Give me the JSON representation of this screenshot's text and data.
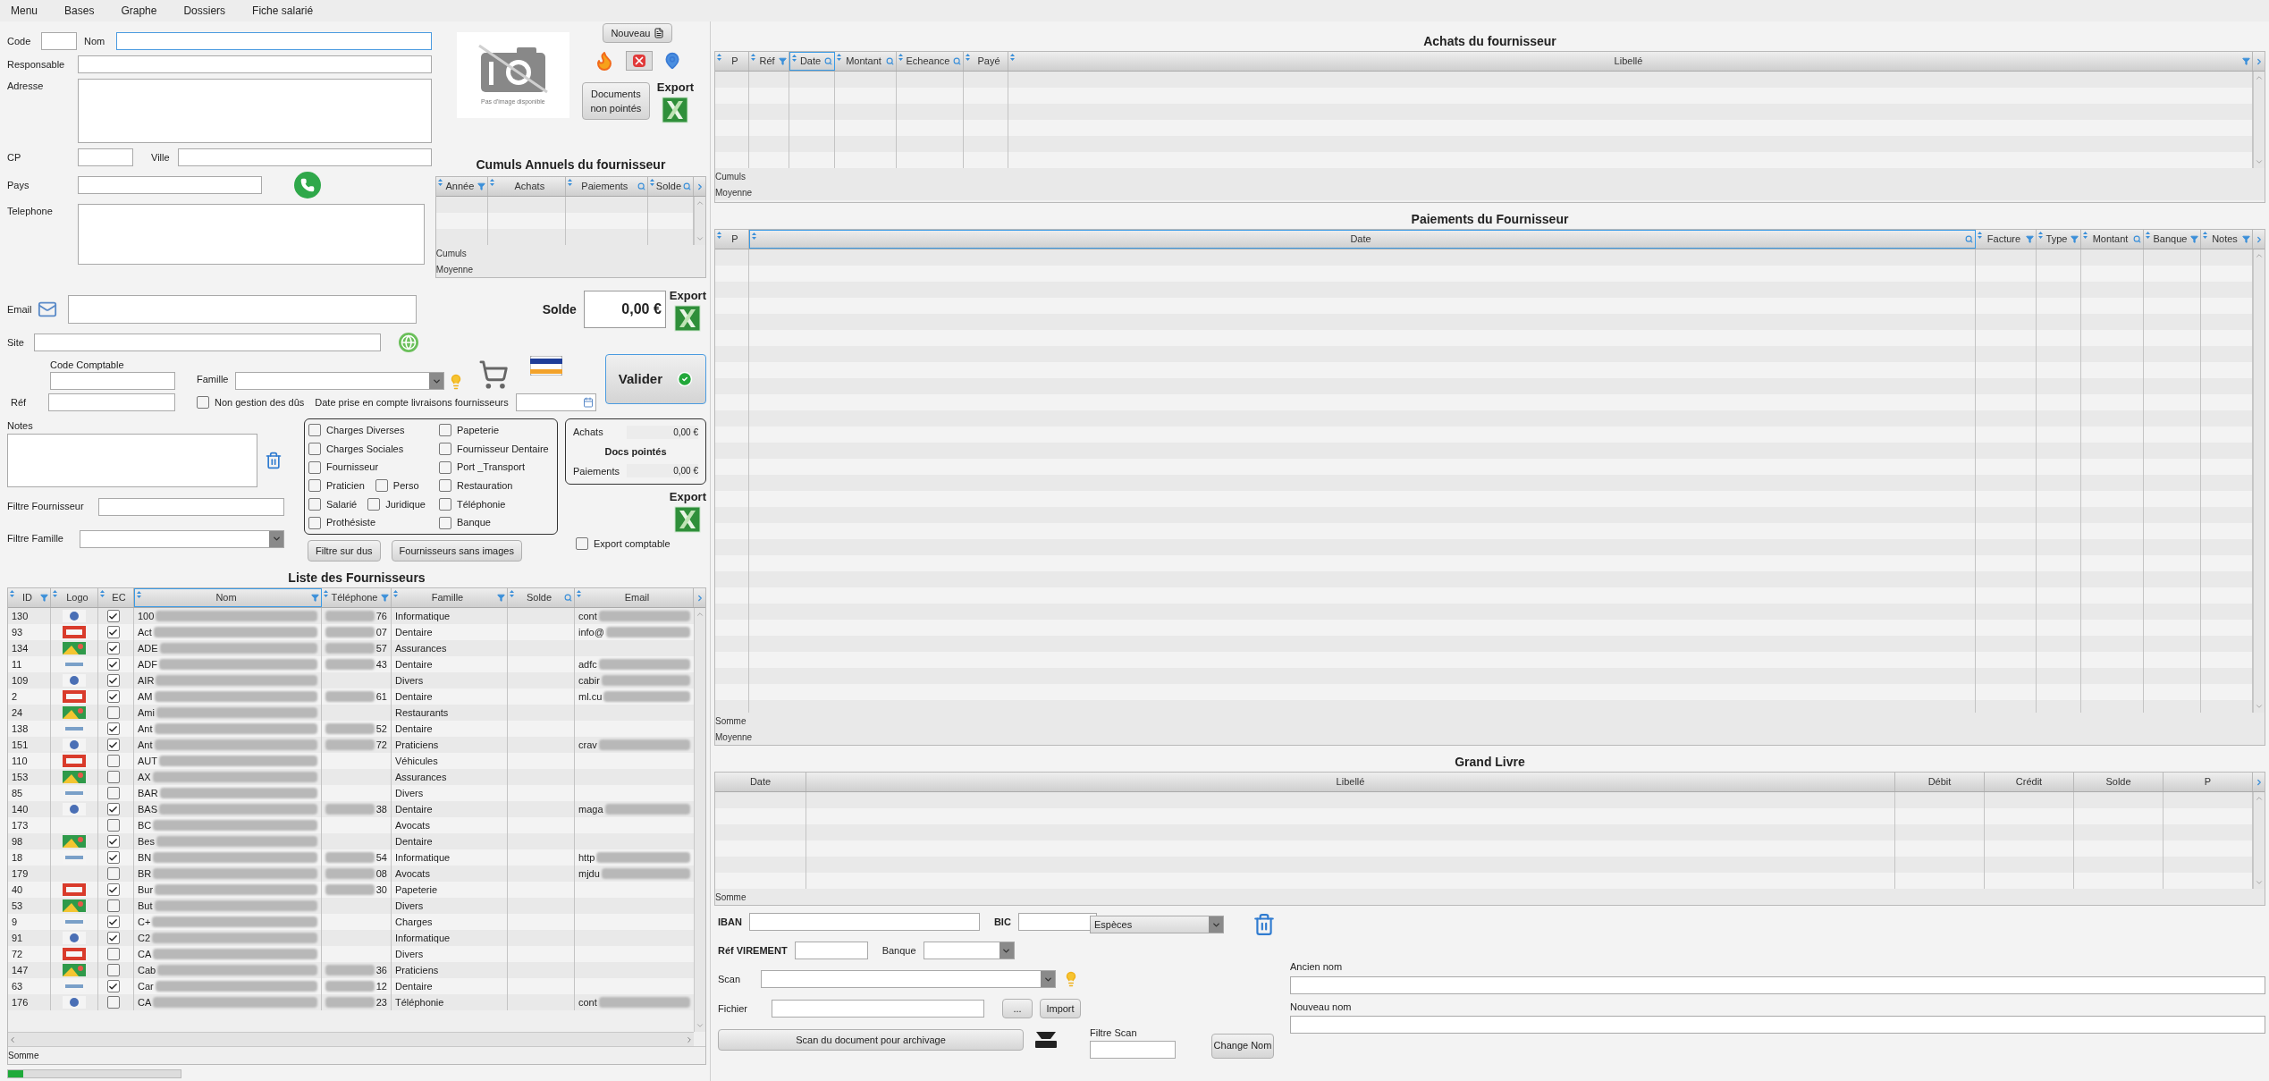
{
  "menu": [
    {
      "label": "Menu"
    },
    {
      "label": "Bases"
    },
    {
      "label": "Graphe"
    },
    {
      "label": "Dossiers"
    },
    {
      "label": "Fiche salarié"
    }
  ],
  "form": {
    "code": "Code",
    "nom": "Nom",
    "responsable": "Responsable",
    "adresse": "Adresse",
    "cp": "CP",
    "ville": "Ville",
    "pays": "Pays",
    "telephone": "Telephone",
    "email": "Email",
    "site": "Site",
    "code_comptable": "Code Comptable",
    "famille": "Famille",
    "ref": "Réf",
    "notes": "Notes",
    "filtre_fournisseur": "Filtre Fournisseur",
    "filtre_famille": "Filtre Famille",
    "date_prise": "Date prise en compte livraisons fournisseurs"
  },
  "non_gestion": {
    "label": "Non gestion des dûs",
    "checked": false
  },
  "photo_placeholder": {
    "caption": "Pas d'image disponible"
  },
  "buttons": {
    "nouveau": "Nouveau",
    "documents": "Documents non pointés",
    "valider": "Valider",
    "filtre_dus": "Filtre sur dus",
    "sans_images": "Fournisseurs sans images"
  },
  "exports": [
    "Export",
    "Export",
    "Export"
  ],
  "solde": {
    "label": "Solde",
    "value": "0,00 €"
  },
  "cumuls": {
    "title": "Cumuls Annuels du fournisseur",
    "columns": [
      {
        "label": "Année",
        "kind": "filter",
        "selected": false
      },
      {
        "label": "Achats",
        "kind": "plain",
        "selected": false
      },
      {
        "label": "Paiements",
        "kind": "search",
        "selected": false
      },
      {
        "label": "Solde",
        "kind": "search",
        "selected": false
      }
    ],
    "footer": [
      "Cumuls",
      "Moyenne"
    ]
  },
  "categories": [
    {
      "left": [
        {
          "label": "Charges Diverses",
          "checked": false
        }
      ],
      "right": {
        "label": "Papeterie",
        "checked": false
      }
    },
    {
      "left": [
        {
          "label": "Charges Sociales",
          "checked": false
        }
      ],
      "right": {
        "label": "Fournisseur Dentaire",
        "checked": false
      }
    },
    {
      "left": [
        {
          "label": "Fournisseur",
          "checked": false
        }
      ],
      "right": {
        "label": "Port _Transport",
        "checked": false
      }
    },
    {
      "left": [
        {
          "label": "Praticien",
          "checked": false
        },
        {
          "label": "Perso",
          "checked": false
        }
      ],
      "right": {
        "label": "Restauration",
        "checked": false
      }
    },
    {
      "left": [
        {
          "label": "Salarié",
          "checked": false
        },
        {
          "label": "Juridique",
          "checked": false
        }
      ],
      "right": {
        "label": "Téléphonie",
        "checked": false
      }
    },
    {
      "left": [
        {
          "label": "Prothésiste",
          "checked": false
        }
      ],
      "right": {
        "label": "Banque",
        "checked": false
      }
    }
  ],
  "summary": {
    "achats_label": "Achats",
    "achats_value": "0,00 €",
    "docs_label": "Docs pointés",
    "paiements_label": "Paiements",
    "paiements_value": "0,00 €"
  },
  "export_comptable": {
    "label": "Export comptable",
    "checked": false
  },
  "suppliers": {
    "title": "Liste des Fournisseurs",
    "columns": [
      {
        "label": "ID",
        "kind": "filter",
        "selected": false
      },
      {
        "label": "Logo",
        "kind": "plain",
        "selected": false
      },
      {
        "label": "EC",
        "kind": "plain",
        "selected": false
      },
      {
        "label": "Nom",
        "kind": "filter",
        "selected": true
      },
      {
        "label": "Téléphone",
        "kind": "filter",
        "selected": false
      },
      {
        "label": "Famille",
        "kind": "filter",
        "selected": false
      },
      {
        "label": "Solde",
        "kind": "search",
        "selected": false
      },
      {
        "label": "Email",
        "kind": "plain",
        "selected": false
      }
    ],
    "rows": [
      {
        "id": "130",
        "logo": true,
        "ec": true,
        "nom": "100",
        "tel": "76",
        "famille": "Informatique",
        "email": "cont"
      },
      {
        "id": "93",
        "logo": true,
        "ec": true,
        "nom": "Act",
        "tel": "07",
        "famille": "Dentaire",
        "email": "info@"
      },
      {
        "id": "134",
        "logo": true,
        "ec": true,
        "nom": "ADE",
        "tel": "57",
        "famille": "Assurances"
      },
      {
        "id": "11",
        "logo": true,
        "ec": true,
        "nom": "ADF",
        "tel": "43",
        "famille": "Dentaire",
        "email": "adfc"
      },
      {
        "id": "109",
        "logo": true,
        "ec": true,
        "nom": "AIR",
        "famille": "Divers",
        "email": "cabir"
      },
      {
        "id": "2",
        "logo": true,
        "ec": true,
        "nom": "AM",
        "tel": "61",
        "famille": "Dentaire",
        "email": "ml.cu"
      },
      {
        "id": "24",
        "logo": true,
        "ec": false,
        "nom": "Ami",
        "famille": "Restaurants"
      },
      {
        "id": "138",
        "logo": true,
        "ec": true,
        "nom": "Ant",
        "tel": "52",
        "famille": "Dentaire"
      },
      {
        "id": "151",
        "logo": true,
        "ec": true,
        "nom": "Ant",
        "tel": "72",
        "famille": "Praticiens",
        "email": "crav"
      },
      {
        "id": "110",
        "logo": true,
        "ec": false,
        "nom": "AUT",
        "famille": "Véhicules"
      },
      {
        "id": "153",
        "logo": true,
        "ec": false,
        "nom": "AX",
        "famille": "Assurances"
      },
      {
        "id": "85",
        "logo": true,
        "ec": false,
        "nom": "BAR",
        "famille": "Divers"
      },
      {
        "id": "140",
        "logo": true,
        "ec": true,
        "nom": "BAS",
        "tel": "38",
        "famille": "Dentaire",
        "email": "maga"
      },
      {
        "id": "173",
        "logo": false,
        "ec": false,
        "nom": "BC",
        "famille": "Avocats"
      },
      {
        "id": "98",
        "logo": true,
        "ec": true,
        "nom": "Bes",
        "famille": "Dentaire"
      },
      {
        "id": "18",
        "logo": true,
        "ec": true,
        "nom": "BN",
        "tel": "54",
        "famille": "Informatique",
        "email": "http"
      },
      {
        "id": "179",
        "logo": false,
        "ec": false,
        "nom": "BR",
        "tel": "08",
        "famille": "Avocats",
        "email": "mjdu"
      },
      {
        "id": "40",
        "logo": true,
        "ec": true,
        "nom": "Bur",
        "tel": "30",
        "famille": "Papeterie"
      },
      {
        "id": "53",
        "logo": true,
        "ec": false,
        "nom": "But",
        "famille": "Divers"
      },
      {
        "id": "9",
        "logo": true,
        "ec": true,
        "nom": "C+",
        "famille": "Charges"
      },
      {
        "id": "91",
        "logo": true,
        "ec": true,
        "nom": "C2",
        "famille": "Informatique"
      },
      {
        "id": "72",
        "logo": true,
        "ec": false,
        "nom": "CA",
        "famille": "Divers"
      },
      {
        "id": "147",
        "logo": true,
        "ec": false,
        "nom": "Cab",
        "tel": "36",
        "famille": "Praticiens"
      },
      {
        "id": "63",
        "logo": true,
        "ec": true,
        "nom": "Car",
        "tel": "12",
        "famille": "Dentaire"
      },
      {
        "id": "176",
        "logo": true,
        "ec": false,
        "nom": "CA",
        "tel": "23",
        "famille": "Téléphonie",
        "email": "cont"
      }
    ],
    "footer": "Somme"
  },
  "status": {
    "level": 0.09
  },
  "achats": {
    "title": "Achats du fournisseur",
    "columns": [
      {
        "label": "P",
        "kind": "plain",
        "selected": false
      },
      {
        "label": "Réf",
        "kind": "filter",
        "selected": false
      },
      {
        "label": "Date",
        "kind": "search",
        "selected": true
      },
      {
        "label": "Montant",
        "kind": "search",
        "selected": false
      },
      {
        "label": "Echeance",
        "kind": "search",
        "selected": false
      },
      {
        "label": "Payé",
        "kind": "plain",
        "selected": false
      },
      {
        "label": "Libellé",
        "kind": "filter",
        "selected": false
      }
    ],
    "footer": [
      "Cumuls",
      "Moyenne"
    ]
  },
  "paiements": {
    "title": "Paiements du Fournisseur",
    "columns": [
      {
        "label": "P",
        "kind": "plain",
        "selected": false
      },
      {
        "label": "Date",
        "kind": "search",
        "selected": true
      },
      {
        "label": "Facture",
        "kind": "filter",
        "selected": false
      },
      {
        "label": "Type",
        "kind": "filter",
        "selected": false
      },
      {
        "label": "Montant",
        "kind": "search",
        "selected": false
      },
      {
        "label": "Banque",
        "kind": "filter",
        "selected": false
      },
      {
        "label": "Notes",
        "kind": "filter",
        "selected": false
      }
    ],
    "footer": [
      "Somme",
      "Moyenne"
    ]
  },
  "grand_livre": {
    "title": "Grand Livre",
    "columns": [
      {
        "label": "Date",
        "selected": false
      },
      {
        "label": "Libellé",
        "selected": false
      },
      {
        "label": "Débit",
        "selected": false
      },
      {
        "label": "Crédit",
        "selected": false
      },
      {
        "label": "Solde",
        "selected": false
      },
      {
        "label": "P",
        "selected": false
      }
    ],
    "footer": [
      "Somme"
    ]
  },
  "bank": {
    "iban": "IBAN",
    "bic": "BIC",
    "mode": "Espèces",
    "ref_virement": "Réf VIREMENT",
    "banque": "Banque",
    "scan": "Scan",
    "fichier": "Fichier",
    "browse": "...",
    "import": "Import",
    "ancien_nom": "Ancien nom",
    "nouveau_nom": "Nouveau nom",
    "scan_button": "Scan du document pour archivage",
    "filtre_scan": "Filtre Scan",
    "change_nom": "Change Nom"
  }
}
